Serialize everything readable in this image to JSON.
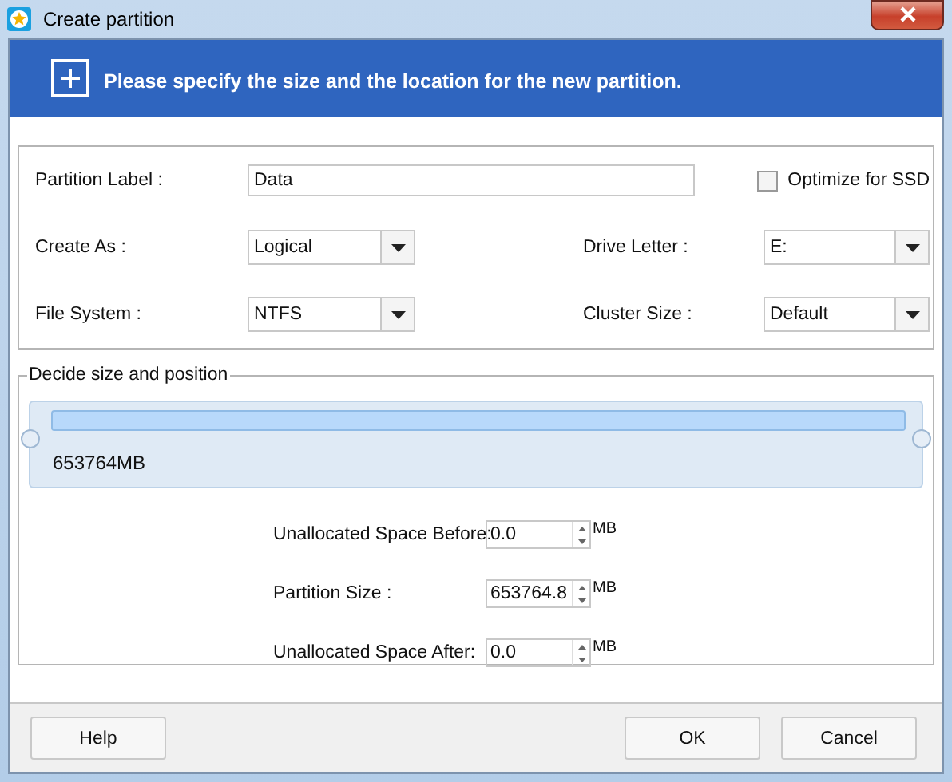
{
  "window": {
    "title": "Create partition"
  },
  "header": {
    "text": "Please specify the size and the location for the new partition."
  },
  "fields": [
    {
      "kind": "text",
      "label": "Partition Label :",
      "value": "Data"
    },
    {
      "kind": "checkbox",
      "label": "Optimize for SSD",
      "checked": false
    },
    {
      "kind": "combo",
      "label": "Create As :",
      "value": "Logical"
    },
    {
      "kind": "combo",
      "label": "Drive Letter :",
      "value": "E:"
    },
    {
      "kind": "combo",
      "label": "File System :",
      "value": "NTFS"
    },
    {
      "kind": "combo",
      "label": "Cluster Size :",
      "value": "Default"
    }
  ],
  "position": {
    "title": "Decide size and position",
    "partition_bar": {
      "size": "653764MB"
    },
    "size_fields": [
      {
        "label": "Unallocated Space Before:",
        "value": "0.0",
        "unit": "MB"
      },
      {
        "label": "Partition Size :",
        "value": "653764.8",
        "unit": "MB"
      },
      {
        "label": "Unallocated Space After:",
        "value": "0.0",
        "unit": "MB"
      }
    ]
  },
  "buttons": [
    {
      "label": "Help"
    },
    {
      "label": "OK"
    },
    {
      "label": "Cancel"
    }
  ]
}
